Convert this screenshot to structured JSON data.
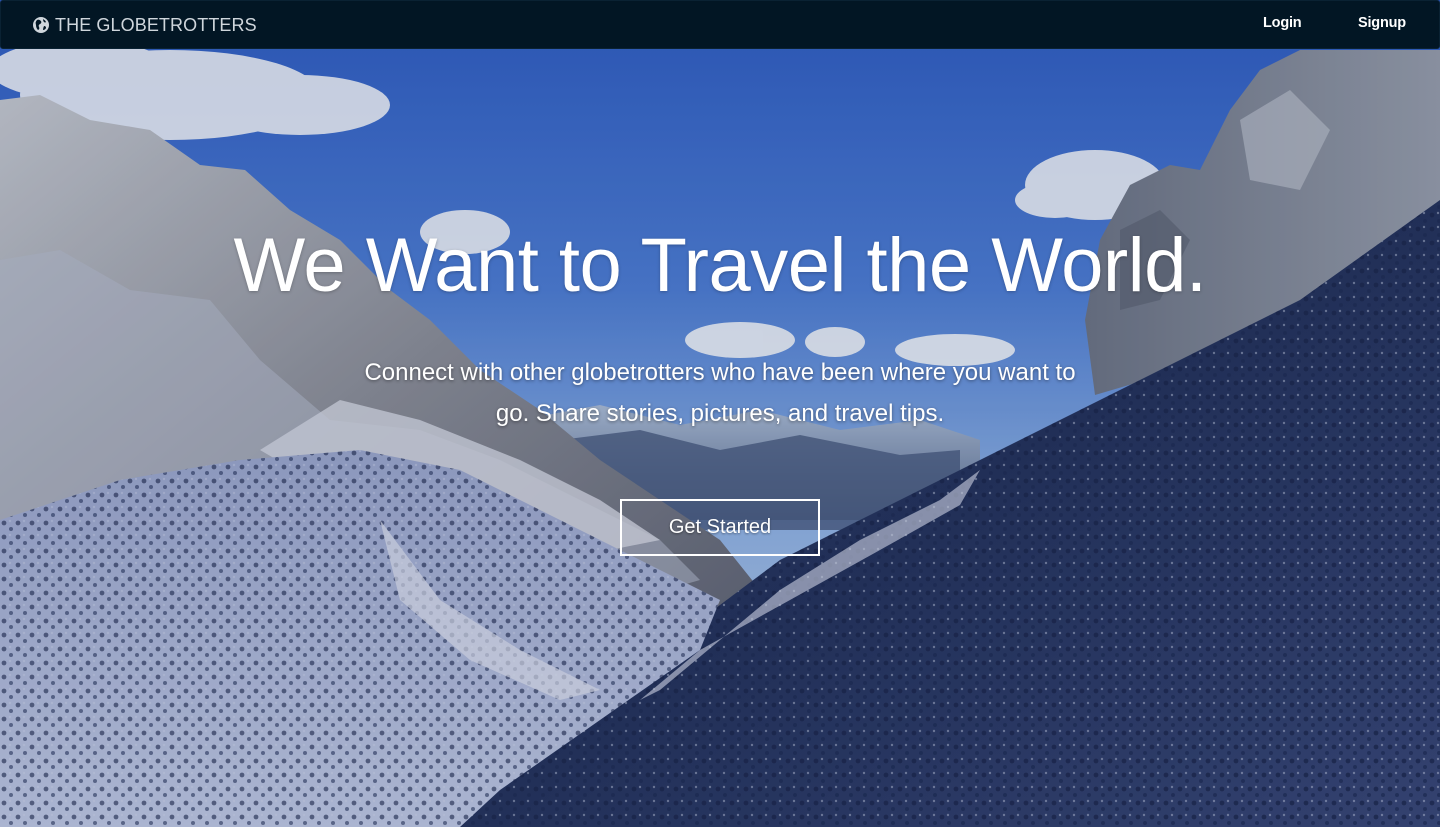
{
  "navbar": {
    "brand_icon": "globe-icon",
    "brand_label": "THE GLOBETROTTERS",
    "login_label": "Login",
    "signup_label": "Signup",
    "background_color": "#021624"
  },
  "hero": {
    "headline": "We Want to Travel the World.",
    "subtext": "Connect with other globetrotters who have been where you want to go. Share stories, pictures, and travel tips.",
    "cta_label": "Get Started",
    "background_image": "snowy-mountain-valley"
  }
}
